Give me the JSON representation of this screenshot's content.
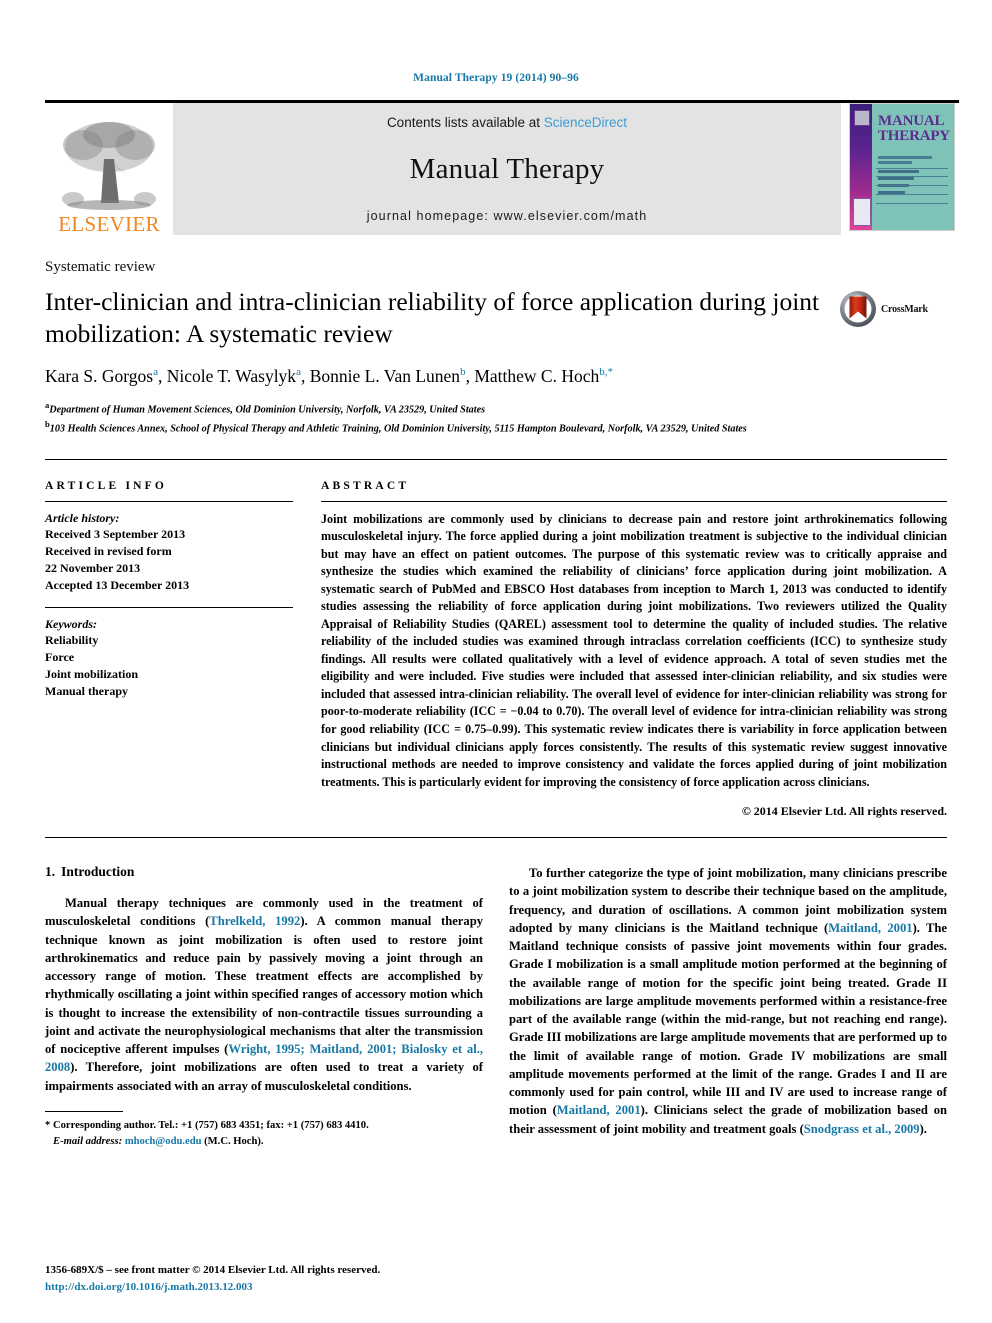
{
  "running_head": "Manual Therapy 19 (2014) 90–96",
  "masthead": {
    "publisher_name": "ELSEVIER",
    "contents_prefix": "Contents lists available at ",
    "sciencedirect": "ScienceDirect",
    "journal_title": "Manual Therapy",
    "homepage": "journal homepage: www.elsevier.com/math",
    "cover": {
      "title_line1": "MANUAL",
      "title_line2": "THERAPY"
    }
  },
  "article": {
    "type_label": "Systematic review",
    "title": "Inter-clinician and intra-clinician reliability of force application during joint mobilization: A systematic review",
    "crossmark_label": "CrossMark",
    "authors": [
      {
        "name": "Kara S. Gorgos",
        "sup": "a",
        "sep": ", "
      },
      {
        "name": "Nicole T. Wasylyk",
        "sup": "a",
        "sep": ", "
      },
      {
        "name": "Bonnie L. Van Lunen",
        "sup": "b",
        "sep": ", "
      },
      {
        "name": "Matthew C. Hoch",
        "sup": "b,*",
        "sep": ""
      }
    ],
    "affiliations": [
      {
        "marker": "a",
        "text": "Department of Human Movement Sciences, Old Dominion University, Norfolk, VA 23529, United States"
      },
      {
        "marker": "b",
        "text": "103 Health Sciences Annex, School of Physical Therapy and Athletic Training, Old Dominion University, 5115 Hampton Boulevard, Norfolk, VA 23529, United States"
      }
    ]
  },
  "article_info": {
    "heading": "ARTICLE INFO",
    "history_title": "Article history:",
    "history": [
      "Received 3 September 2013",
      "Received in revised form",
      "22 November 2013",
      "Accepted 13 December 2013"
    ],
    "keywords_title": "Keywords:",
    "keywords": [
      "Reliability",
      "Force",
      "Joint mobilization",
      "Manual therapy"
    ]
  },
  "abstract": {
    "heading": "ABSTRACT",
    "text": "Joint mobilizations are commonly used by clinicians to decrease pain and restore joint arthrokinematics following musculoskeletal injury. The force applied during a joint mobilization treatment is subjective to the individual clinician but may have an effect on patient outcomes. The purpose of this systematic review was to critically appraise and synthesize the studies which examined the reliability of clinicians’ force application during joint mobilization. A systematic search of PubMed and EBSCO Host databases from inception to March 1, 2013 was conducted to identify studies assessing the reliability of force application during joint mobilizations. Two reviewers utilized the Quality Appraisal of Reliability Studies (QAREL) assessment tool to determine the quality of included studies. The relative reliability of the included studies was examined through intraclass correlation coefficients (ICC) to synthesize study findings. All results were collated qualitatively with a level of evidence approach. A total of seven studies met the eligibility and were included. Five studies were included that assessed inter-clinician reliability, and six studies were included that assessed intra-clinician reliability. The overall level of evidence for inter-clinician reliability was strong for poor-to-moderate reliability (ICC = −0.04 to 0.70). The overall level of evidence for intra-clinician reliability was strong for good reliability (ICC = 0.75–0.99). This systematic review indicates there is variability in force application between clinicians but individual clinicians apply forces consistently. The results of this systematic review suggest innovative instructional methods are needed to improve consistency and validate the forces applied during of joint mobilization treatments. This is particularly evident for improving the consistency of force application across clinicians.",
    "copyright": "© 2014 Elsevier Ltd. All rights reserved."
  },
  "body": {
    "section_number": "1.",
    "section_title": "Introduction",
    "left_paragraph_1": {
      "part1": "Manual therapy techniques are commonly used in the treatment of musculoskeletal conditions (",
      "cit1": "Threlkeld, 1992",
      "part2": "). A common manual therapy technique known as joint mobilization is often used to restore joint arthrokinematics and reduce pain by passively moving a joint through an accessory range of motion. These treatment effects are accomplished by rhythmically oscillating a joint within specified ranges of accessory motion which is thought to increase the extensibility of non-contractile tissues surrounding a joint and activate the neurophysiological mechanisms that alter the transmission of nociceptive afferent impulses (",
      "cit2": "Wright, 1995; Maitland, 2001; Bialosky et al., 2008",
      "part3": "). Therefore, joint mobilizations are often used to treat a variety of impairments associated with an array of musculoskeletal conditions."
    },
    "right_paragraph_1": {
      "part1": "To further categorize the type of joint mobilization, many clinicians prescribe to a joint mobilization system to describe their technique based on the amplitude, frequency, and duration of oscillations. A common joint mobilization system adopted by many clinicians is the Maitland technique (",
      "cit1": "Maitland, 2001",
      "part2": "). The Maitland technique consists of passive joint movements within four grades. Grade I mobilization is a small amplitude motion performed at the beginning of the available range of motion for the specific joint being treated. Grade II mobilizations are large amplitude movements performed within a resistance-free part of the available range (within the mid-range, but not reaching end range). Grade III mobilizations are large amplitude movements that are performed up to the limit of available range of motion. Grade IV mobilizations are small amplitude movements performed at the limit of the range. Grades I and II are commonly used for pain control, while III and IV are used to increase range of motion (",
      "cit2": "Maitland, 2001",
      "part3": "). Clinicians select the grade of mobilization based on their assessment of joint mobility and treatment goals (",
      "cit3": "Snodgrass et al., 2009",
      "part4": ")."
    },
    "corresponding_note": {
      "marker": "*",
      "line1": "Corresponding author. Tel.: +1 (757) 683 4351; fax: +1 (757) 683 4410.",
      "email_label": "E-mail address:",
      "email": "mhoch@odu.edu",
      "email_suffix": " (M.C. Hoch)."
    }
  },
  "footer": {
    "issn_line": "1356-689X/$ – see front matter © 2014 Elsevier Ltd. All rights reserved.",
    "doi": "http://dx.doi.org/10.1016/j.math.2013.12.003"
  },
  "colors": {
    "link_blue": "#1678a6",
    "sciencedirect_blue": "#3c9bd1",
    "elsevier_orange": "#f0861f",
    "banner_grey": "#e3e3e3"
  }
}
